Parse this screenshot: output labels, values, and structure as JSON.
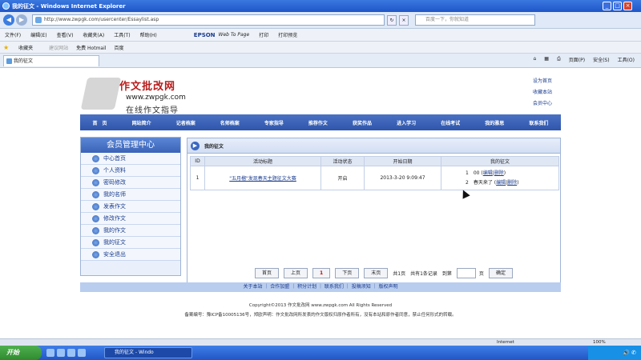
{
  "window": {
    "title": "我的征文 - Windows Internet Explorer"
  },
  "address": {
    "url": "http://www.zwpgk.com/usercenter/Essaylist.asp",
    "search_placeholder": "百度一下，你就知道"
  },
  "menu": [
    "文件(F)",
    "编辑(E)",
    "查看(V)",
    "收藏夹(A)",
    "工具(T)",
    "帮助(H)"
  ],
  "toolbar": {
    "epson": "EPSON",
    "wtp": "Web To Page",
    "print": "打印",
    "preview": "打印预览"
  },
  "favorites": {
    "fav": "收藏夹",
    "suggest": "建议网站",
    "hotmail": "免费 Hotmail",
    "baidu": "百度"
  },
  "tab": {
    "label": "我的征文",
    "page": "页面(P)",
    "safety": "安全(S)",
    "tools": "工具(O)"
  },
  "site": {
    "name": "作文批改网",
    "url": "www.zwpgk.com",
    "slogan": "在线作文指导",
    "toplinks": [
      "设为首页",
      "收藏本站",
      "会员中心"
    ],
    "nav": [
      "首　页",
      "网站简介",
      "记者档案",
      "名师档案",
      "专家指导",
      "推荐作文",
      "获奖作品",
      "进入学习",
      "在线考试",
      "我的雅思",
      "联系我们"
    ]
  },
  "sidebar": {
    "title": "会员管理中心",
    "items": [
      "中心首页",
      "个人资料",
      "密码修改",
      "我的名师",
      "发表作文",
      "修改作文",
      "我的作文",
      "我的征文",
      "安全退出"
    ]
  },
  "panel": {
    "title": "我的征文",
    "columns": [
      "ID",
      "活动标题",
      "活动状态",
      "开始日期",
      "我的征文"
    ],
    "row": {
      "id": "1",
      "title": "\"五月榴\"发现春天主题征文大赛",
      "status": "开启",
      "date": "2013-3-20 9:09:47",
      "works": [
        {
          "no": "1",
          "name": "00",
          "edit": "编辑",
          "del": "删除"
        },
        {
          "no": "2",
          "name": "春天来了",
          "edit": "编辑",
          "del": "删除"
        }
      ]
    },
    "pager": {
      "first": "首页",
      "prev": "上页",
      "current": "1",
      "next": "下页",
      "last": "末页",
      "pages": "共1页",
      "total": "共有1条记录",
      "goto": "到第",
      "unit": "页",
      "confirm": "确定"
    }
  },
  "footer": {
    "links": "关于本站 ｜ 合作加盟 ｜ 积分计划 ｜ 联系我们 ｜ 投稿须知 ｜ 版权声明",
    "copyright": "Copyright©2013 作文批改网 www.zwpgk.com All Rights Reserved",
    "record": "备案编号：豫ICP备10005136号，郑欧声明：作文批改网所发表的作文版权归原作者所有，没有本站和原作者同意，禁止任何形式的转载。"
  },
  "status": {
    "zone": "Internet",
    "zoom": "100%"
  },
  "taskbar": {
    "start": "开始",
    "task": "我的征文 - Windo"
  }
}
